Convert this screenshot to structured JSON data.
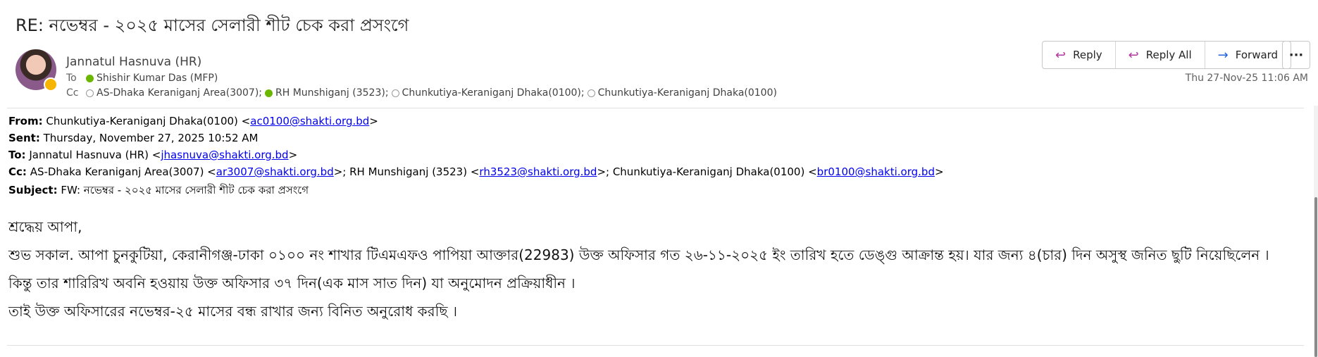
{
  "subject": "RE: নভেম্বর - ২০২৫ মাসের সেলারী শীট চেক করা প্রসংগে",
  "sender": {
    "name": "Jannatul Hasnuva (HR)"
  },
  "to": {
    "label": "To",
    "recipients": [
      "Shishir Kumar Das (MFP)"
    ]
  },
  "cc": {
    "label": "Cc",
    "recipients": [
      "AS-Dhaka Keraniganj Area(3007);",
      "RH Munshiganj (3523);",
      "Chunkutiya-Keraniganj Dhaka(0100);",
      "Chunkutiya-Keraniganj Dhaka(0100)"
    ]
  },
  "actions": {
    "reply": "Reply",
    "reply_all": "Reply All",
    "forward": "Forward",
    "more": "···"
  },
  "date": "Thu 27-Nov-25 11:06 AM",
  "fwd_header": {
    "from_label": "From:",
    "from_name": "Chunkutiya-Keraniganj Dhaka(0100) <",
    "from_email": "ac0100@shakti.org.bd",
    "from_close": ">",
    "sent_label": "Sent:",
    "sent_value": "Thursday, November 27, 2025 10:52 AM",
    "to_label": "To:",
    "to_name": "Jannatul Hasnuva (HR) <",
    "to_email": "jhasnuva@shakti.org.bd",
    "to_close": ">",
    "cc_label": "Cc:",
    "cc_1_name": "AS-Dhaka Keraniganj Area(3007) <",
    "cc_1_email": "ar3007@shakti.org.bd",
    "cc_2_name": ">; RH Munshiganj (3523) <",
    "cc_2_email": "rh3523@shakti.org.bd",
    "cc_3_name": ">; Chunkutiya-Keraniganj Dhaka(0100) <",
    "cc_3_email": "br0100@shakti.org.bd",
    "cc_close": ">",
    "subject_label": "Subject:",
    "subject_value": "FW: নভেম্বর - ২০২৫ মাসের সেলারী শীট চেক করা প্রসংগে"
  },
  "body": [
    "শ্রদ্ধেয় আপা,",
    "শুভ সকাল. আপা চুনকুটিয়া, কেরানীগঞ্জ-ঢাকা ০১০০ নং শাখার টিএমএফও পাপিয়া আক্তার(22983) উক্ত অফিসার গত ২৬-১১-২০২৫ ইং তারিখ হতে ডেঙ্গু আক্রান্ত হয়। যার জন্য ৪(চার) দিন অসুস্থ জনিত ছুটি নিয়েছিলেন ।",
    "কিন্তু তার শারিরিখ অবনি হওয়ায় উক্ত অফিসার ৩৭ দিন(এক মাস সাত দিন) যা অনুমোদন প্রক্রিয়াধীন ।",
    "তাই উক্ত অফিসারের নভেম্বর-২৫ মাসের বন্ধ রাখার জন্য বিনিত অনুরোধ করছি ।"
  ]
}
